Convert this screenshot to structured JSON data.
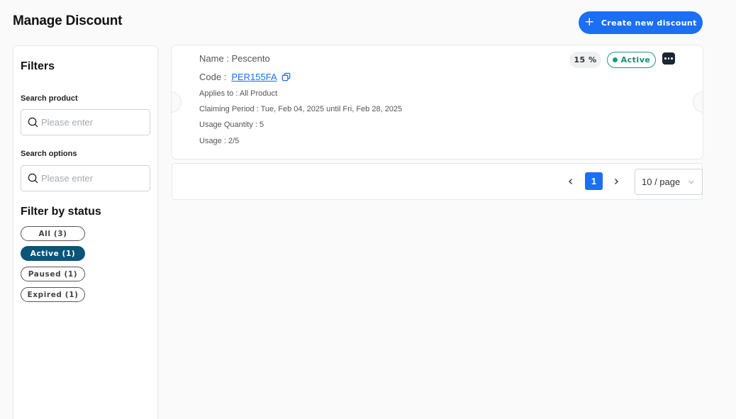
{
  "header": {
    "title": "Manage Discount",
    "create_button_label": "Create new discount"
  },
  "filters": {
    "title": "Filters",
    "search_product_label": "Search product",
    "search_product_placeholder": "Please enter",
    "search_options_label": "Search options",
    "search_options_placeholder": "Please enter",
    "status_title": "Filter by status",
    "statuses": [
      {
        "label": "All (3)",
        "selected": false
      },
      {
        "label": "Active (1)",
        "selected": true
      },
      {
        "label": "Paused (1)",
        "selected": false
      },
      {
        "label": "Expired (1)",
        "selected": false
      }
    ]
  },
  "discount": {
    "name": "Name : Pescento",
    "code_label": "Code :",
    "code": "PER155FA",
    "applies_to": "Applies to : All Product",
    "claiming_period": "Claiming Period : Tue, Feb 04, 2025 until Fri, Feb 28, 2025",
    "usage_quantity": "Usage Quantity : 5",
    "usage": "Usage : 2/5",
    "percent": "15 %",
    "status": "Active",
    "status_color": "#1a9a7d"
  },
  "pagination": {
    "current_page": "1",
    "page_size": "10 / page"
  },
  "colors": {
    "primary": "#1a6ff2",
    "active_filter": "#0c5479",
    "more_button": "#1c2533"
  },
  "icons": [
    "plus-icon",
    "search-icon",
    "copy-icon",
    "more-icon",
    "chevron-left-icon",
    "chevron-right-icon",
    "chevron-down-icon"
  ]
}
